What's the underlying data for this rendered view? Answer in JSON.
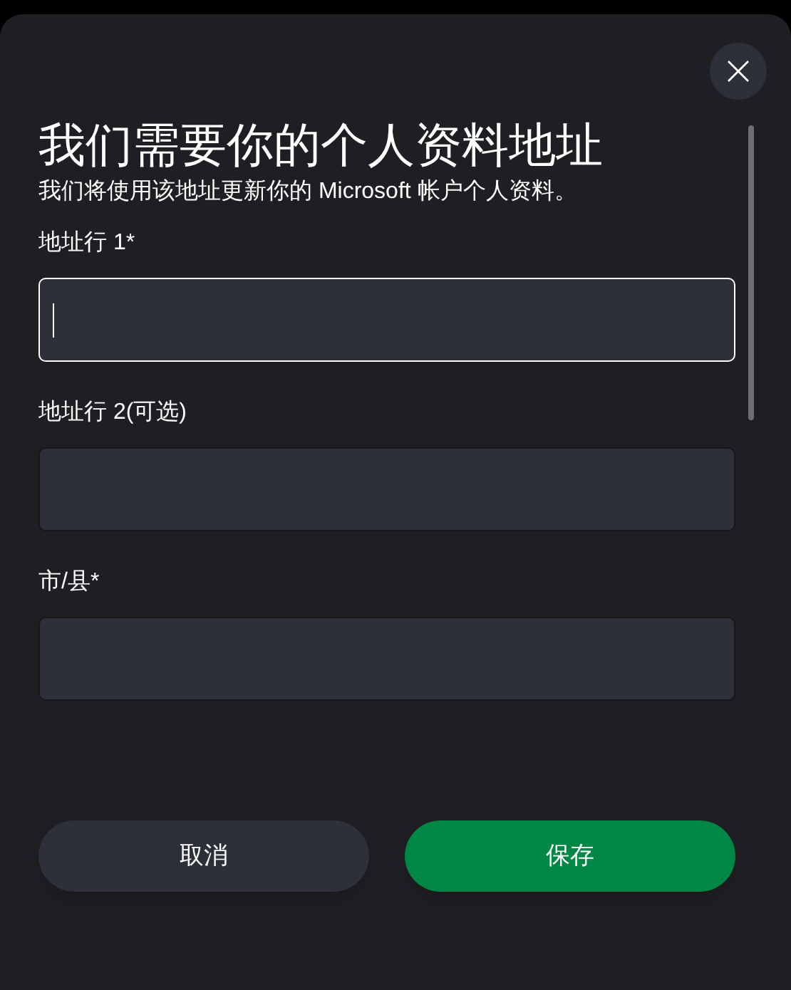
{
  "dialog": {
    "title": "我们需要你的个人资料地址",
    "subtitle": "我们将使用该地址更新你的 Microsoft 帐户个人资料。"
  },
  "fields": [
    {
      "label": "地址行 1*",
      "focused": true
    },
    {
      "label": "地址行 2(可选)",
      "focused": false
    },
    {
      "label": "市/县*",
      "focused": false
    }
  ],
  "buttons": [
    {
      "label": "取消",
      "kind": "secondary"
    },
    {
      "label": "保存",
      "kind": "primary"
    }
  ]
}
